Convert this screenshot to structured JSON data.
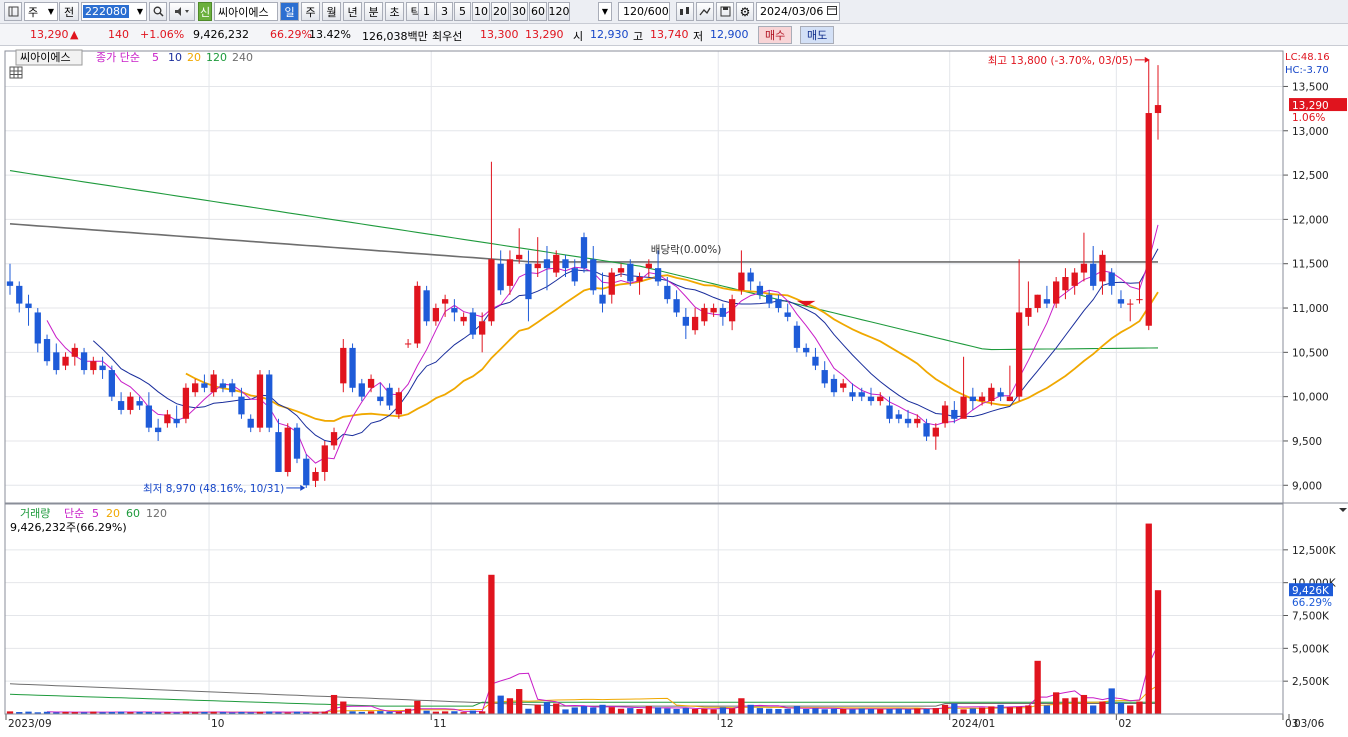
{
  "toolbar": {
    "period_select": "주",
    "market": "전",
    "code": "222080",
    "credit_badge": "신",
    "stock_name": "씨아이에스",
    "periods": [
      "일",
      "주",
      "월",
      "년",
      "분",
      "초",
      "틱"
    ],
    "active_period": "일",
    "intervals": [
      "1",
      "3",
      "5",
      "10",
      "20",
      "30",
      "60",
      "120"
    ],
    "count": "120",
    "count_total": "/600",
    "date": "2024/03/06"
  },
  "quote": {
    "price": "13,290",
    "arrow": "▲",
    "change": "140",
    "change_pct": "+1.06%",
    "volume": "9,426,232",
    "vol_ratio": "66.29%",
    "turnover": "13.42%",
    "amount": "126,038백만",
    "best_label": "최우선",
    "ask": "13,300",
    "bid": "13,290",
    "open_label": "시",
    "open": "12,930",
    "high_label": "고",
    "high": "13,740",
    "low_label": "저",
    "low": "12,900",
    "buy_label": "매수",
    "sell_label": "매도"
  },
  "price_panel": {
    "name_box": "씨아이에스",
    "legend": {
      "label": "종가 단순",
      "periods": [
        "5",
        "10",
        "20",
        "120",
        "240"
      ]
    },
    "lc": "LC:48.16",
    "hc": "HC:-3.70",
    "high_note": "최고 13,800 (-3.70%, 03/05)",
    "low_note": "최저 8,970 (48.16%, 10/31)",
    "dividend_note": "배당락(0.00%)",
    "current_price": "13,290",
    "current_pct": "1.06%",
    "yticks": [
      "13,500",
      "13,000",
      "12,500",
      "12,000",
      "11,500",
      "11,000",
      "10,500",
      "10,000",
      "9,500",
      "9,000"
    ]
  },
  "volume_panel": {
    "legend": {
      "label": "거래량",
      "sub": "단순",
      "periods": [
        "5",
        "20",
        "60",
        "120"
      ]
    },
    "info": "9,426,232주(66.29%)",
    "current": "9,426K",
    "current_pct": "66.29%",
    "yticks": [
      "12,500K",
      "10,000K",
      "7,500K",
      "5,000K",
      "2,500K"
    ]
  },
  "xaxis": {
    "labels": [
      "2023/09",
      "10",
      "11",
      "12",
      "2024/01",
      "02",
      "03",
      "03/06"
    ]
  },
  "colors": {
    "up": "#E0141E",
    "down": "#1E5BD8",
    "ma5": "#C81EC8",
    "ma10": "#1A2E9C",
    "ma20": "#F0A800",
    "ma120": "#1E9A3C",
    "ma240": "#6E6E6E"
  },
  "chart_data": {
    "type": "candlestick",
    "dates_note": "daily candles 2023/09 – 2024/03/06",
    "ohlc": [
      [
        11300,
        11500,
        11150,
        11250
      ],
      [
        11250,
        11300,
        10950,
        11050
      ],
      [
        11050,
        11150,
        10800,
        11000
      ],
      [
        10950,
        11000,
        10500,
        10600
      ],
      [
        10650,
        10700,
        10350,
        10400
      ],
      [
        10500,
        10600,
        10250,
        10300
      ],
      [
        10350,
        10500,
        10300,
        10450
      ],
      [
        10450,
        10600,
        10350,
        10550
      ],
      [
        10500,
        10550,
        10250,
        10300
      ],
      [
        10300,
        10450,
        10250,
        10400
      ],
      [
        10350,
        10450,
        10200,
        10300
      ],
      [
        10300,
        10350,
        9950,
        10000
      ],
      [
        9950,
        10050,
        9800,
        9850
      ],
      [
        9850,
        10050,
        9800,
        10000
      ],
      [
        9950,
        10000,
        9850,
        9900
      ],
      [
        9900,
        10050,
        9600,
        9650
      ],
      [
        9650,
        9750,
        9500,
        9600
      ],
      [
        9700,
        9850,
        9650,
        9800
      ],
      [
        9750,
        9900,
        9650,
        9700
      ],
      [
        9750,
        10150,
        9700,
        10100
      ],
      [
        10050,
        10200,
        10000,
        10150
      ],
      [
        10150,
        10250,
        10050,
        10100
      ],
      [
        10050,
        10300,
        10000,
        10250
      ],
      [
        10150,
        10200,
        10050,
        10100
      ],
      [
        10150,
        10200,
        10000,
        10050
      ],
      [
        10000,
        10100,
        9750,
        9800
      ],
      [
        9750,
        9800,
        9600,
        9650
      ],
      [
        9650,
        10300,
        9600,
        10250
      ],
      [
        10250,
        10300,
        9600,
        9650
      ],
      [
        9600,
        9750,
        9150,
        9150
      ],
      [
        9150,
        9700,
        9100,
        9650
      ],
      [
        9650,
        9700,
        9250,
        9300
      ],
      [
        9300,
        9350,
        8970,
        9000
      ],
      [
        9050,
        9200,
        8980,
        9150
      ],
      [
        9150,
        9500,
        9050,
        9450
      ],
      [
        9450,
        9650,
        9400,
        9600
      ],
      [
        10150,
        10650,
        10050,
        10550
      ],
      [
        10550,
        10600,
        10050,
        10100
      ],
      [
        10150,
        10200,
        9950,
        10000
      ],
      [
        10100,
        10250,
        10050,
        10200
      ],
      [
        10000,
        10150,
        9900,
        9950
      ],
      [
        10100,
        10150,
        9850,
        9900
      ],
      [
        9800,
        10100,
        9750,
        10050
      ],
      [
        10600,
        10650,
        10550,
        10600
      ],
      [
        10600,
        11300,
        10550,
        11250
      ],
      [
        11200,
        11250,
        10800,
        10850
      ],
      [
        10850,
        11050,
        10800,
        11000
      ],
      [
        11050,
        11150,
        10900,
        11100
      ],
      [
        11000,
        11100,
        10850,
        10950
      ],
      [
        10850,
        10950,
        10800,
        10900
      ],
      [
        10950,
        11000,
        10650,
        10700
      ],
      [
        10700,
        10950,
        10500,
        10850
      ],
      [
        10850,
        12650,
        10800,
        11550
      ],
      [
        11500,
        11650,
        11150,
        11200
      ],
      [
        11250,
        11650,
        11150,
        11550
      ],
      [
        11550,
        11900,
        11500,
        11600
      ],
      [
        11500,
        11650,
        10850,
        11100
      ],
      [
        11450,
        11800,
        11350,
        11500
      ],
      [
        11550,
        11700,
        11200,
        11450
      ],
      [
        11400,
        11650,
        11350,
        11600
      ],
      [
        11550,
        11600,
        11350,
        11450
      ],
      [
        11450,
        11550,
        11250,
        11300
      ],
      [
        11800,
        11850,
        11400,
        11450
      ],
      [
        11550,
        11700,
        11150,
        11200
      ],
      [
        11150,
        11400,
        10950,
        11050
      ],
      [
        11150,
        11450,
        11050,
        11400
      ],
      [
        11400,
        11500,
        11350,
        11450
      ],
      [
        11500,
        11550,
        11250,
        11300
      ],
      [
        11300,
        11400,
        11150,
        11350
      ],
      [
        11450,
        11550,
        11350,
        11500
      ],
      [
        11450,
        11650,
        11250,
        11300
      ],
      [
        11250,
        11350,
        11050,
        11100
      ],
      [
        11100,
        11200,
        10900,
        10950
      ],
      [
        10900,
        11000,
        10650,
        10800
      ],
      [
        10750,
        11000,
        10700,
        10900
      ],
      [
        10850,
        11050,
        10800,
        11000
      ],
      [
        10950,
        11050,
        10900,
        11000
      ],
      [
        11000,
        11050,
        10800,
        10900
      ],
      [
        10850,
        11150,
        10750,
        11100
      ],
      [
        11200,
        11650,
        11150,
        11400
      ],
      [
        11400,
        11450,
        11200,
        11300
      ],
      [
        11250,
        11300,
        11100,
        11150
      ],
      [
        11150,
        11200,
        11000,
        11050
      ],
      [
        11100,
        11150,
        10950,
        11000
      ],
      [
        10950,
        11050,
        10850,
        10900
      ],
      [
        10800,
        10850,
        10500,
        10550
      ],
      [
        10550,
        10600,
        10450,
        10500
      ],
      [
        10450,
        10550,
        10300,
        10350
      ],
      [
        10300,
        10400,
        10100,
        10150
      ],
      [
        10200,
        10250,
        10000,
        10050
      ],
      [
        10100,
        10200,
        10050,
        10150
      ],
      [
        10050,
        10150,
        9950,
        10000
      ],
      [
        10050,
        10100,
        9950,
        10000
      ],
      [
        10000,
        10100,
        9900,
        9950
      ],
      [
        9950,
        10050,
        9900,
        10000
      ],
      [
        9900,
        10000,
        9700,
        9750
      ],
      [
        9800,
        9850,
        9700,
        9750
      ],
      [
        9750,
        9850,
        9650,
        9700
      ],
      [
        9700,
        9800,
        9650,
        9750
      ],
      [
        9700,
        9750,
        9500,
        9550
      ],
      [
        9550,
        9700,
        9400,
        9650
      ],
      [
        9700,
        9950,
        9650,
        9900
      ],
      [
        9850,
        9950,
        9700,
        9750
      ],
      [
        9750,
        10450,
        9800,
        10000
      ],
      [
        10000,
        10100,
        9850,
        9950
      ],
      [
        9950,
        10050,
        9900,
        10000
      ],
      [
        9950,
        10150,
        9900,
        10100
      ],
      [
        10050,
        10100,
        9950,
        10000
      ],
      [
        9950,
        10350,
        9950,
        10000
      ],
      [
        10000,
        11550,
        9950,
        10950
      ],
      [
        10900,
        11300,
        10800,
        11000
      ],
      [
        11000,
        11150,
        10950,
        11150
      ],
      [
        11100,
        11250,
        11000,
        11050
      ],
      [
        11050,
        11350,
        11000,
        11300
      ],
      [
        11200,
        11450,
        11100,
        11350
      ],
      [
        11250,
        11450,
        11150,
        11400
      ],
      [
        11400,
        11850,
        11300,
        11500
      ],
      [
        11500,
        11700,
        11200,
        11250
      ],
      [
        11300,
        11650,
        11150,
        11600
      ],
      [
        11400,
        11450,
        11150,
        11250
      ],
      [
        11100,
        11200,
        11000,
        11050
      ],
      [
        11050,
        11100,
        10850,
        11050
      ],
      [
        11100,
        11300,
        11050,
        11100
      ],
      [
        10800,
        13800,
        10750,
        13200
      ],
      [
        13200,
        13740,
        12900,
        13290
      ]
    ],
    "volume_k": [
      200,
      150,
      180,
      130,
      170,
      120,
      160,
      140,
      120,
      180,
      130,
      150,
      170,
      140,
      160,
      150,
      120,
      140,
      110,
      190,
      130,
      150,
      170,
      140,
      110,
      150,
      120,
      160,
      190,
      130,
      110,
      170,
      120,
      140,
      180,
      1450,
      950,
      200,
      160,
      200,
      220,
      170,
      180,
      400,
      1000,
      250,
      180,
      200,
      210,
      140,
      260,
      200,
      10600,
      1400,
      1200,
      1900,
      400,
      700,
      900,
      800,
      350,
      500,
      600,
      500,
      700,
      520,
      400,
      450,
      380,
      600,
      500,
      420,
      380,
      450,
      380,
      400,
      350,
      500,
      420,
      1200,
      700,
      450,
      400,
      380,
      400,
      600,
      380,
      420,
      360,
      400,
      380,
      350,
      420,
      380,
      360,
      380,
      400,
      360,
      420,
      380,
      450,
      700,
      800,
      350,
      420,
      480,
      580,
      700,
      520,
      550,
      650,
      4050,
      650,
      1650,
      1200,
      1250,
      1450,
      650,
      950,
      1950,
      850,
      650,
      950,
      14500,
      9426
    ],
    "y_range_price": [
      8800,
      13900
    ],
    "y_range_volume_k": [
      0,
      15000
    ],
    "series_names": [
      "종가 단순 5",
      "10",
      "20",
      "120",
      "240"
    ]
  }
}
